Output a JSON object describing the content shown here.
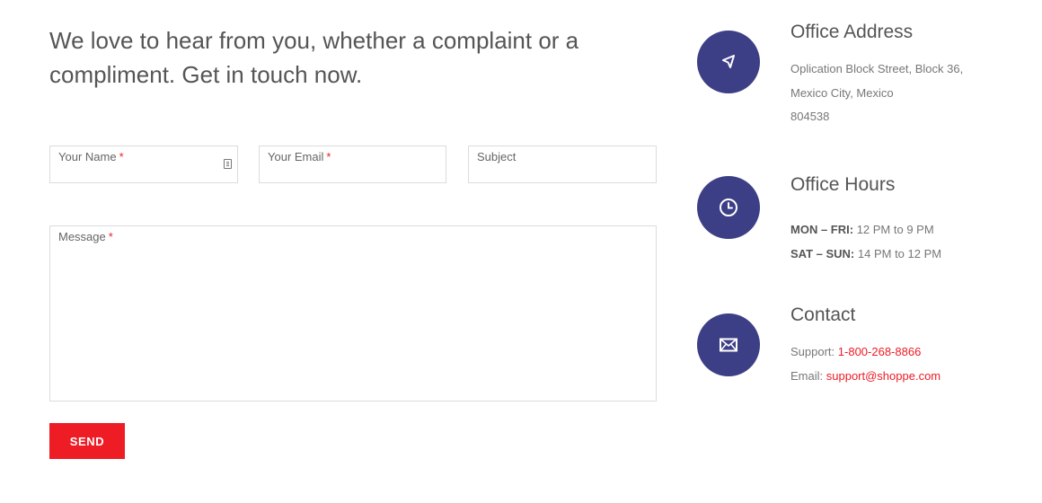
{
  "intro": {
    "line1": "We love to hear from you, whether a complaint or a",
    "line2": "compliment. Get in touch now."
  },
  "form": {
    "name_label": "Your Name",
    "email_label": "Your Email",
    "subject_label": "Subject",
    "message_label": "Message",
    "required_mark": "*",
    "send_label": "SEND"
  },
  "address": {
    "title": "Office Address",
    "line1": "Oplication Block Street, Block 36,",
    "line2": "Mexico City, Mexico",
    "line3": "804538",
    "icon": "navigation-arrow-icon"
  },
  "hours": {
    "title": "Office Hours",
    "weekday_label": "MON – FRI:",
    "weekday_value": "12 PM to 9 PM",
    "weekend_label": "SAT – SUN:",
    "weekend_value": "14 PM to 12 PM",
    "icon": "clock-icon"
  },
  "contact": {
    "title": "Contact",
    "support_label": "Support:",
    "support_value": "1-800-268-8866",
    "email_label": "Email:",
    "email_value": "support@shoppe.com",
    "icon": "envelope-icon"
  },
  "colors": {
    "accent": "#ee1c25",
    "icon_circle": "#3d3f86"
  }
}
